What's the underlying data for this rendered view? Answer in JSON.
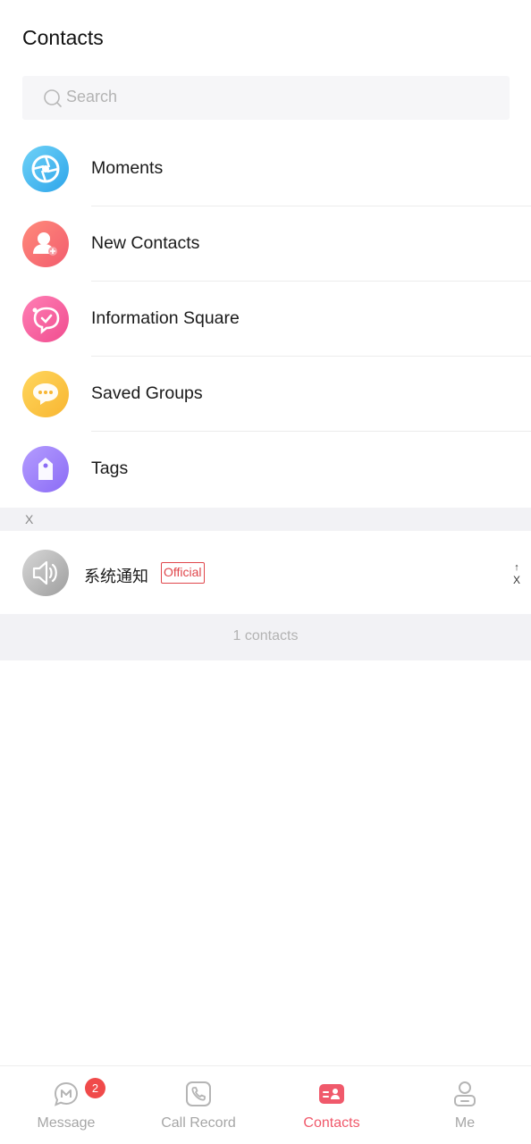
{
  "header": {
    "title": "Contacts"
  },
  "search": {
    "placeholder": "Search"
  },
  "menu": {
    "items": [
      {
        "label": "Moments",
        "icon": "moments-shutter-icon",
        "color": "#2ea5ea"
      },
      {
        "label": "New Contacts",
        "icon": "add-person-icon",
        "color": "#f25c6e"
      },
      {
        "label": "Information Square",
        "icon": "chat-heart-icon",
        "color": "#f04d8f"
      },
      {
        "label": "Saved Groups",
        "icon": "group-chat-icon",
        "color": "#f8b632"
      },
      {
        "label": "Tags",
        "icon": "tag-icon",
        "color": "#8b6cf5"
      }
    ]
  },
  "contacts": {
    "section_letter": "X",
    "items": [
      {
        "name": "系统通知",
        "badge": "Official",
        "avatar_icon": "speaker-icon"
      }
    ],
    "count_text": "1 contacts"
  },
  "index_bar": {
    "arrow": "↑",
    "letter": "X"
  },
  "tabbar": {
    "active": "Contacts",
    "accent_color": "#f0596b",
    "tabs": [
      {
        "label": "Message",
        "icon": "message-icon",
        "badge": "2"
      },
      {
        "label": "Call Record",
        "icon": "phone-icon"
      },
      {
        "label": "Contacts",
        "icon": "contacts-card-icon"
      },
      {
        "label": "Me",
        "icon": "person-icon"
      }
    ]
  }
}
